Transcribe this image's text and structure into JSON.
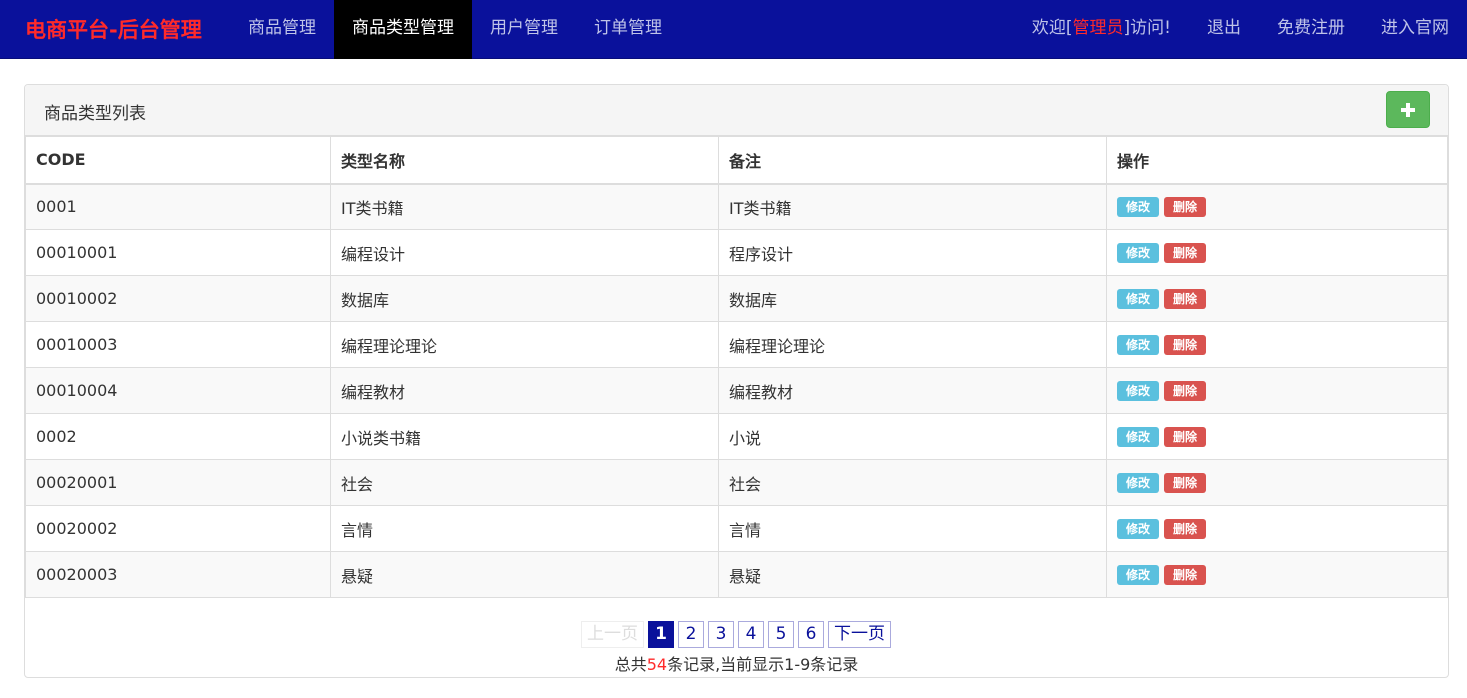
{
  "brand": "电商平台-后台管理",
  "nav": {
    "left": [
      "商品管理",
      "商品类型管理",
      "用户管理",
      "订单管理"
    ],
    "active_index": 1,
    "welcome_prefix": "欢迎[",
    "admin_name": "管理员",
    "welcome_suffix": "]访问!",
    "logout": "退出",
    "register": "免费注册",
    "official": "进入官网"
  },
  "panel": {
    "title": "商品类型列表",
    "add_icon": "plus-icon"
  },
  "table": {
    "headers": [
      "CODE",
      "类型名称",
      "备注",
      "操作"
    ],
    "edit_label": "修改",
    "delete_label": "删除",
    "rows": [
      {
        "code": "0001",
        "name": "IT类书籍",
        "remark": "IT类书籍"
      },
      {
        "code": "00010001",
        "name": "编程设计",
        "remark": "程序设计"
      },
      {
        "code": "00010002",
        "name": "数据库",
        "remark": "数据库"
      },
      {
        "code": "00010003",
        "name": "编程理论理论",
        "remark": "编程理论理论"
      },
      {
        "code": "00010004",
        "name": "编程教材",
        "remark": "编程教材"
      },
      {
        "code": "0002",
        "name": "小说类书籍",
        "remark": "小说"
      },
      {
        "code": "00020001",
        "name": "社会",
        "remark": "社会"
      },
      {
        "code": "00020002",
        "name": "言情",
        "remark": "言情"
      },
      {
        "code": "00020003",
        "name": "悬疑",
        "remark": "悬疑"
      }
    ]
  },
  "pagination": {
    "prev": "上一页",
    "pages": [
      "1",
      "2",
      "3",
      "4",
      "5",
      "6"
    ],
    "current": "1",
    "next": "下一页",
    "summary_prefix": "总共",
    "total": "54",
    "summary_suffix": "条记录,当前显示1-9条记录"
  },
  "colors": {
    "navbar": "#0a119b",
    "brand": "#ff2a2a",
    "add": "#5cb85c",
    "edit": "#5bc0de",
    "delete": "#d9534f"
  }
}
